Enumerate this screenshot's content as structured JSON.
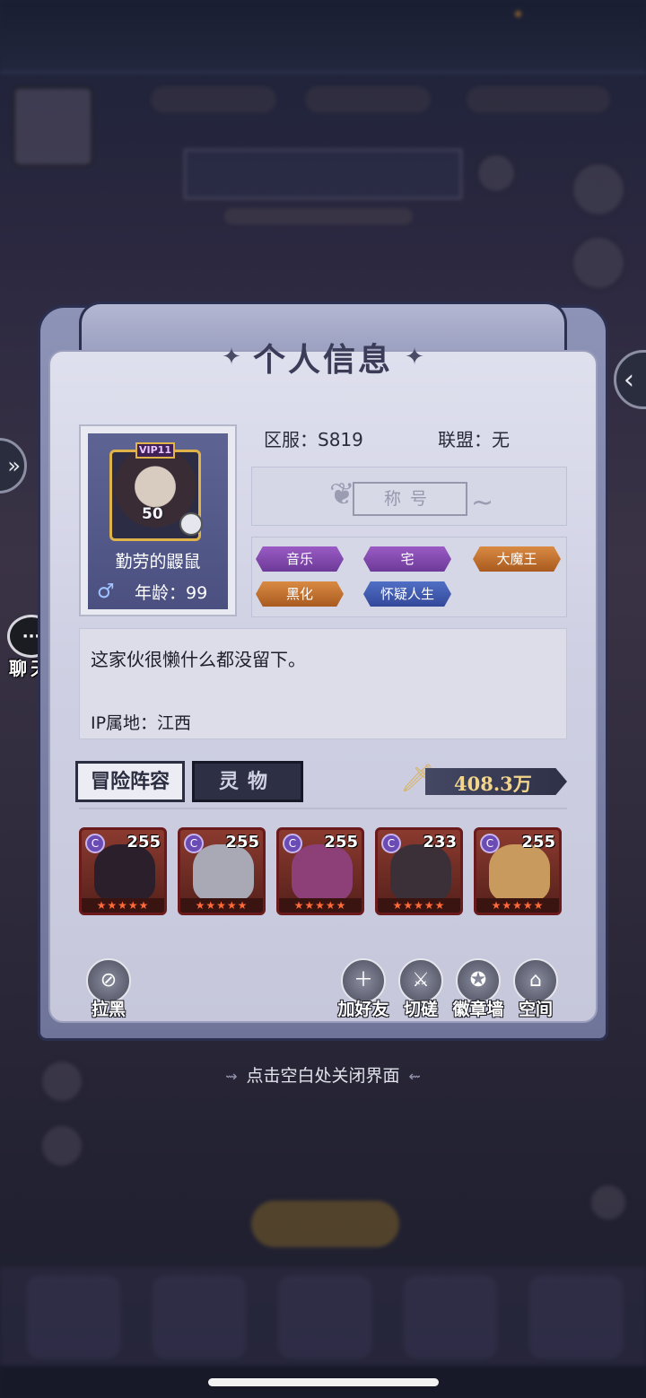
{
  "panel": {
    "title": "个人信息",
    "title_star": "✦",
    "player": {
      "name": "勤劳的鼹鼠",
      "vip": "VIP11",
      "level": "50",
      "gender_symbol": "♂",
      "age_text": "年龄：99"
    },
    "server": {
      "label": "区服：S819"
    },
    "alliance": {
      "label": "联盟：无"
    },
    "title_plate": "称号",
    "tags": [
      {
        "label": "音乐",
        "color": "purple"
      },
      {
        "label": "宅",
        "color": "purple"
      },
      {
        "label": "大魔王",
        "color": "orange"
      },
      {
        "label": "黑化",
        "color": "orange"
      },
      {
        "label": "怀疑人生",
        "color": "blue"
      }
    ],
    "signature": "这家伙很懒什么都没留下。",
    "ip_location": "IP属地：江西",
    "tabs": {
      "team": "冒险阵容",
      "spirit": "灵物"
    },
    "power": "408.3万",
    "heroes": [
      {
        "level": "255",
        "stars": "★★★★★",
        "face_color": "#2b1f2c"
      },
      {
        "level": "255",
        "stars": "★★★★★",
        "face_color": "#a9a9b5"
      },
      {
        "level": "255",
        "stars": "★★★★★",
        "face_color": "#8d3f78"
      },
      {
        "level": "233",
        "stars": "★★★★★",
        "face_color": "#3c3038"
      },
      {
        "level": "255",
        "stars": "★★★★★",
        "face_color": "#c89a5e"
      }
    ],
    "actions": {
      "block": "拉黑",
      "add_friend": "加好友",
      "duel": "切磋",
      "badge_wall": "徽章墙",
      "space": "空间"
    }
  },
  "side": {
    "chat_label": "聊天",
    "chat_icon": "···",
    "right_arrow": "‹",
    "left_arrow": "»"
  },
  "close_hint": "点击空白处关闭界面",
  "colors": {
    "panel_frame": "#8d93b6",
    "panel_inner": "#dfe0ee",
    "power_text": "#f3d58b",
    "tag_purple": "#9a5bc4",
    "tag_orange": "#d98a42",
    "tag_blue": "#4f6fc4"
  }
}
